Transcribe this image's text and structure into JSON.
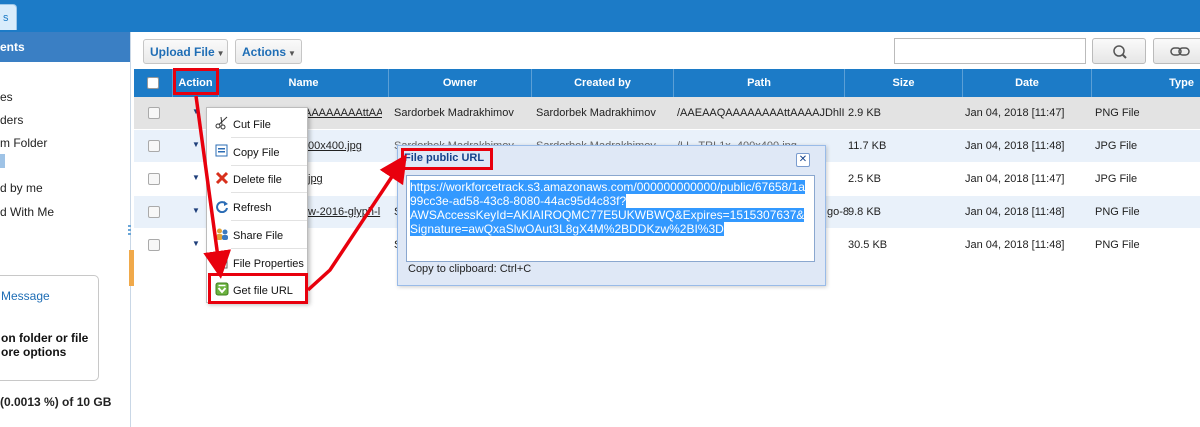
{
  "app": {
    "tab_fragment": "s"
  },
  "sidebar": {
    "header": "ents",
    "items": [
      {
        "label": "es",
        "icon": "files-icon"
      },
      {
        "label": "ders",
        "icon": "folders-icon"
      },
      {
        "label": "m Folder",
        "icon": "custom-folder-icon"
      },
      {
        "label": "d by me",
        "icon": "shared-by-me-icon"
      },
      {
        "label": "d With Me",
        "icon": "shared-with-me-icon"
      }
    ],
    "message_box": {
      "title": "Message",
      "body": "on folder or file\nore options"
    },
    "storage": "(0.0013 %) of 10 GB"
  },
  "toolbar": {
    "upload_label": "Upload File",
    "actions_label": "Actions",
    "search_placeholder": "",
    "search_icon": "search-icon",
    "link_icon": "link-icon"
  },
  "table": {
    "columns": [
      "Action",
      "Name",
      "Owner",
      "Created by",
      "Path",
      "Size",
      "Date",
      "Type"
    ],
    "rows": [
      {
        "name": "AAAAAAAAttAAA",
        "owner": "Sardorbek Madrakhimov",
        "created_by": "Sardorbek Madrakhimov",
        "path": "/AAEAAQAAAAAAAAttAAAAJDhlI",
        "size": "2.9 KB",
        "date": "Jan 04, 2018 [11:47]",
        "type": "PNG File"
      },
      {
        "name": "00x400.jpg",
        "owner": "Sardorbek Madrakhimov",
        "created_by": "Sardorbek Madrakhimov",
        "path": "/LL_TRL1x_400x400.jpg",
        "size": "11.7 KB",
        "date": "Jan 04, 2018 [11:48]",
        "type": "JPG File"
      },
      {
        "name": "jpg",
        "owner": "",
        "created_by": "",
        "path": "",
        "size": "2.5 KB",
        "date": "Jan 04, 2018 [11:47]",
        "type": "JPG File"
      },
      {
        "name": "w-2016-glyph-l",
        "owner": "S",
        "created_by": "",
        "path": "go-8",
        "size": "9.8 KB",
        "date": "Jan 04, 2018 [11:48]",
        "type": "PNG File"
      },
      {
        "name": "",
        "owner": "S",
        "created_by": "",
        "path": "",
        "size": "30.5 KB",
        "date": "Jan 04, 2018 [11:48]",
        "type": "PNG File"
      }
    ]
  },
  "context_menu": {
    "items": [
      {
        "label": "Cut File",
        "icon": "scissors-icon"
      },
      {
        "label": "Copy File",
        "icon": "copy-icon"
      },
      {
        "label": "Delete file",
        "icon": "delete-icon"
      },
      {
        "label": "Refresh",
        "icon": "refresh-icon"
      },
      {
        "label": "Share File",
        "icon": "share-icon"
      },
      {
        "label": "File Properties",
        "icon": "properties-icon"
      },
      {
        "label": "Get file URL",
        "icon": "get-url-icon"
      }
    ]
  },
  "dialog": {
    "title": "File public URL",
    "close_icon": "close-icon",
    "url": "https://workforcetrack.s3.amazonaws.com/000000000000/public/67658/1a99cc3e-ad58-43c8-8080-44ac95d4c83f?AWSAccessKeyId=AKIAIROQMC77E5UKWBWQ&Expires=1515307637&Signature=awQxaSlwOAut3L8gX4M%2BDDKzw%2BI%3D",
    "url_lines": [
      "https://workforcetrack.s3.amazonaws.com/000000000000/public/67658/1a",
      "99cc3e-ad58-43c8-8080-44ac95d4c83f?",
      "AWSAccessKeyId=AKIAIROQMC77E5UKWBWQ&Expires=1515307637&",
      "Signature=awQxaSlwOAut3L8gX4M%2BDDKzw%2BI%3D"
    ],
    "hint": "Copy to clipboard: Ctrl+C"
  },
  "annotation_color": "#e8000d"
}
